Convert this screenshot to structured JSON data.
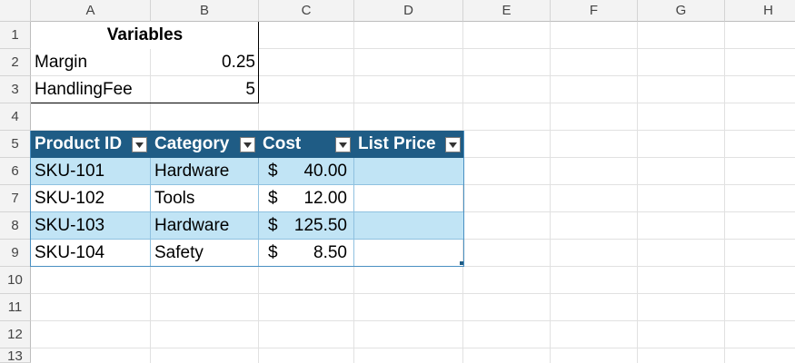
{
  "columns": [
    "A",
    "B",
    "C",
    "D",
    "E",
    "F",
    "G",
    "H"
  ],
  "rows": [
    "1",
    "2",
    "3",
    "4",
    "5",
    "6",
    "7",
    "8",
    "9",
    "10",
    "11",
    "12",
    "13"
  ],
  "variables": {
    "title": "Variables",
    "items": [
      {
        "name": "Margin",
        "value": "0.25"
      },
      {
        "name": "HandlingFee",
        "value": "5"
      }
    ]
  },
  "table": {
    "headers": [
      "Product ID",
      "Category",
      "Cost",
      "List Price"
    ],
    "currency_symbol": "$",
    "rows": [
      {
        "product_id": "SKU-101",
        "category": "Hardware",
        "cost": "40.00",
        "list_price": ""
      },
      {
        "product_id": "SKU-102",
        "category": "Tools",
        "cost": "12.00",
        "list_price": ""
      },
      {
        "product_id": "SKU-103",
        "category": "Hardware",
        "cost": "125.50",
        "list_price": ""
      },
      {
        "product_id": "SKU-104",
        "category": "Safety",
        "cost": "8.50",
        "list_price": ""
      }
    ]
  },
  "colors": {
    "table_header": "#1f5c85",
    "band": "#c1e4f5",
    "table_border": "#4a90c2"
  },
  "icons": {
    "filter": "filter-dropdown-icon",
    "resize": "table-resize-handle-icon"
  }
}
